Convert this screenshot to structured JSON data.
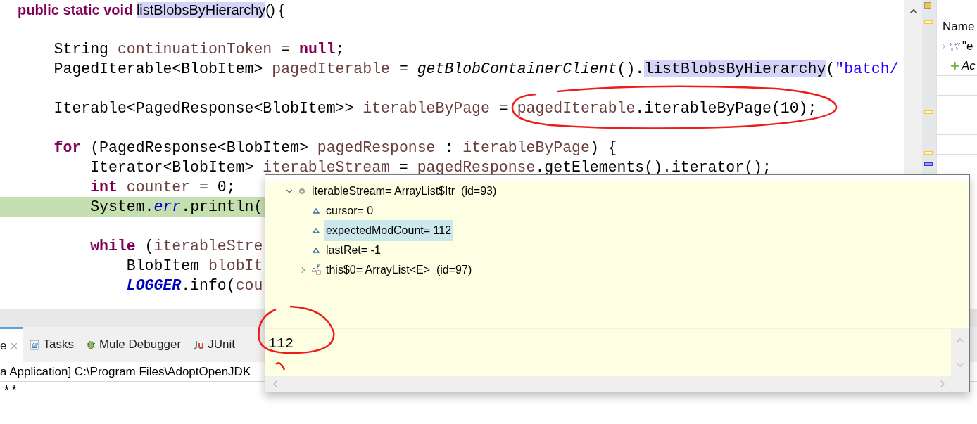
{
  "editor": {
    "header": [
      {
        "text": "public static void ",
        "kind": "keyword"
      },
      {
        "text": "listBlobsByHierarchy",
        "kind": "occurrence"
      },
      {
        "text": "() {",
        "kind": "plain"
      }
    ],
    "lines": [
      {
        "kind": "blank"
      },
      {
        "kind": "code",
        "highlighted": false,
        "tokens": [
          {
            "text": "String ",
            "kind": "plain"
          },
          {
            "text": "continuationToken",
            "kind": "var"
          },
          {
            "text": " = ",
            "kind": "plain"
          },
          {
            "text": "null",
            "kind": "keyword"
          },
          {
            "text": ";",
            "kind": "plain"
          }
        ]
      },
      {
        "kind": "code",
        "highlighted": false,
        "tokens": [
          {
            "text": "PagedIterable<BlobItem> ",
            "kind": "plain"
          },
          {
            "text": "pagedIterable",
            "kind": "var"
          },
          {
            "text": " = ",
            "kind": "plain"
          },
          {
            "text": "getBlobContainerClient",
            "kind": "method"
          },
          {
            "text": "().",
            "kind": "plain"
          },
          {
            "text": "listBlobsByHierarchy",
            "kind": "occurrence"
          },
          {
            "text": "(",
            "kind": "plain"
          },
          {
            "text": "\"batch/",
            "kind": "string"
          }
        ]
      },
      {
        "kind": "blank"
      },
      {
        "kind": "code",
        "highlighted": false,
        "tokens": [
          {
            "text": "Iterable<PagedResponse<BlobItem>> ",
            "kind": "plain"
          },
          {
            "text": "iterableByPage",
            "kind": "var"
          },
          {
            "text": " = ",
            "kind": "plain"
          },
          {
            "text": "pagedIterable",
            "kind": "var"
          },
          {
            "text": ".iterableByPage(10);",
            "kind": "plain"
          }
        ]
      },
      {
        "kind": "blank"
      },
      {
        "kind": "code",
        "highlighted": false,
        "tokens": [
          {
            "text": "for",
            "kind": "keyword"
          },
          {
            "text": " (PagedResponse<BlobItem> ",
            "kind": "plain"
          },
          {
            "text": "pagedResponse",
            "kind": "var"
          },
          {
            "text": " : ",
            "kind": "plain"
          },
          {
            "text": "iterableByPage",
            "kind": "var"
          },
          {
            "text": ") {",
            "kind": "plain"
          }
        ],
        "children": [
          {
            "kind": "code",
            "highlighted": false,
            "tokens": [
              {
                "text": "Iterator<BlobItem> ",
                "kind": "plain"
              },
              {
                "text": "iterableStream",
                "kind": "var"
              },
              {
                "text": " = ",
                "kind": "plain"
              },
              {
                "text": "pagedResponse",
                "kind": "var"
              },
              {
                "text": ".getElements().iterator();",
                "kind": "plain"
              }
            ]
          },
          {
            "kind": "code",
            "highlighted": false,
            "tokens": [
              {
                "text": "int ",
                "kind": "keyword"
              },
              {
                "text": "counter",
                "kind": "var"
              },
              {
                "text": " = 0;",
                "kind": "plain"
              }
            ]
          },
          {
            "kind": "code",
            "highlighted": true,
            "tokens": [
              {
                "text": "System.",
                "kind": "plain"
              },
              {
                "text": "err",
                "kind": "field"
              },
              {
                "text": ".println(",
                "kind": "plain"
              }
            ]
          },
          {
            "kind": "blank"
          },
          {
            "kind": "code",
            "highlighted": false,
            "tokens": [
              {
                "text": "while",
                "kind": "keyword"
              },
              {
                "text": " (",
                "kind": "plain"
              },
              {
                "text": "iterableStre",
                "kind": "var"
              }
            ],
            "children": [
              {
                "kind": "code",
                "highlighted": false,
                "tokens": [
                  {
                    "text": "BlobItem ",
                    "kind": "plain"
                  },
                  {
                    "text": "blobIt",
                    "kind": "var"
                  }
                ]
              },
              {
                "kind": "code",
                "highlighted": false,
                "tokens": [
                  {
                    "text": "LOGGER",
                    "kind": "constant"
                  },
                  {
                    "text": ".info(",
                    "kind": "plain"
                  },
                  {
                    "text": "cou",
                    "kind": "var"
                  }
                ]
              }
            ]
          }
        ]
      }
    ]
  },
  "expressions": {
    "column": "Name",
    "rows": [
      {
        "label": "\"e",
        "kind": "expression"
      },
      {
        "label": "Ac",
        "kind": "add"
      }
    ]
  },
  "tabs": [
    {
      "label": "e",
      "selected": true,
      "closable": true,
      "kind": "console"
    },
    {
      "label": "Tasks",
      "selected": false,
      "closable": false,
      "kind": "tasks"
    },
    {
      "label": "Mule Debugger",
      "selected": false,
      "closable": false,
      "kind": "debugger"
    },
    {
      "label": "JUnit",
      "selected": false,
      "closable": false,
      "kind": "junit"
    }
  ],
  "console": {
    "launch": "a Application] C:\\Program Files\\AdoptOpenJDK",
    "output": "**"
  },
  "inspector": {
    "rows": [
      {
        "label": "iterableStream= ArrayList$Itr  (id=93)",
        "kind": "local",
        "expanded": true,
        "selected": false,
        "children": [
          {
            "label": "cursor= 0",
            "kind": "field",
            "selected": false
          },
          {
            "label": "expectedModCount= 112",
            "kind": "field",
            "selected": true
          },
          {
            "label": "lastRet= -1",
            "kind": "field",
            "selected": false
          },
          {
            "label": "this$0= ArrayList<E>  (id=97)",
            "kind": "outer",
            "expanded": false,
            "selected": false
          }
        ]
      }
    ],
    "detail": "112"
  }
}
